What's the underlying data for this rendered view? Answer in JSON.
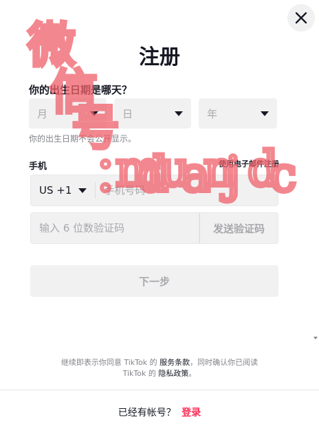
{
  "modal": {
    "title": "注册",
    "birthday_question": "你的出生日期是哪天？",
    "month_placeholder": "月",
    "day_placeholder": "日",
    "year_placeholder": "年",
    "birthday_hint": "你的出生日期不会公开显示。",
    "phone_label": "手机",
    "email_signup_link": "使用电子邮件注册",
    "country_code": "US +1",
    "phone_placeholder": "手机号码",
    "code_placeholder": "输入 6 位数验证码",
    "send_code_label": "发送验证码",
    "next_label": "下一步"
  },
  "terms": {
    "prefix": "继续即表示你同意 TikTok 的 ",
    "service_terms": "服务条款",
    "middle": "，同时确认你已阅读",
    "line2_prefix": "TikTok 的 ",
    "privacy_policy": "隐私政策",
    "suffix": "。"
  },
  "footer": {
    "question": "已经有帐号？",
    "login_link": "登录"
  },
  "watermark": {
    "text": "微信号：mduanjdc",
    "color": "#f0606a"
  },
  "colors": {
    "accent": "#fe2c55",
    "text": "#161823",
    "field_bg": "#f1f1f2"
  }
}
